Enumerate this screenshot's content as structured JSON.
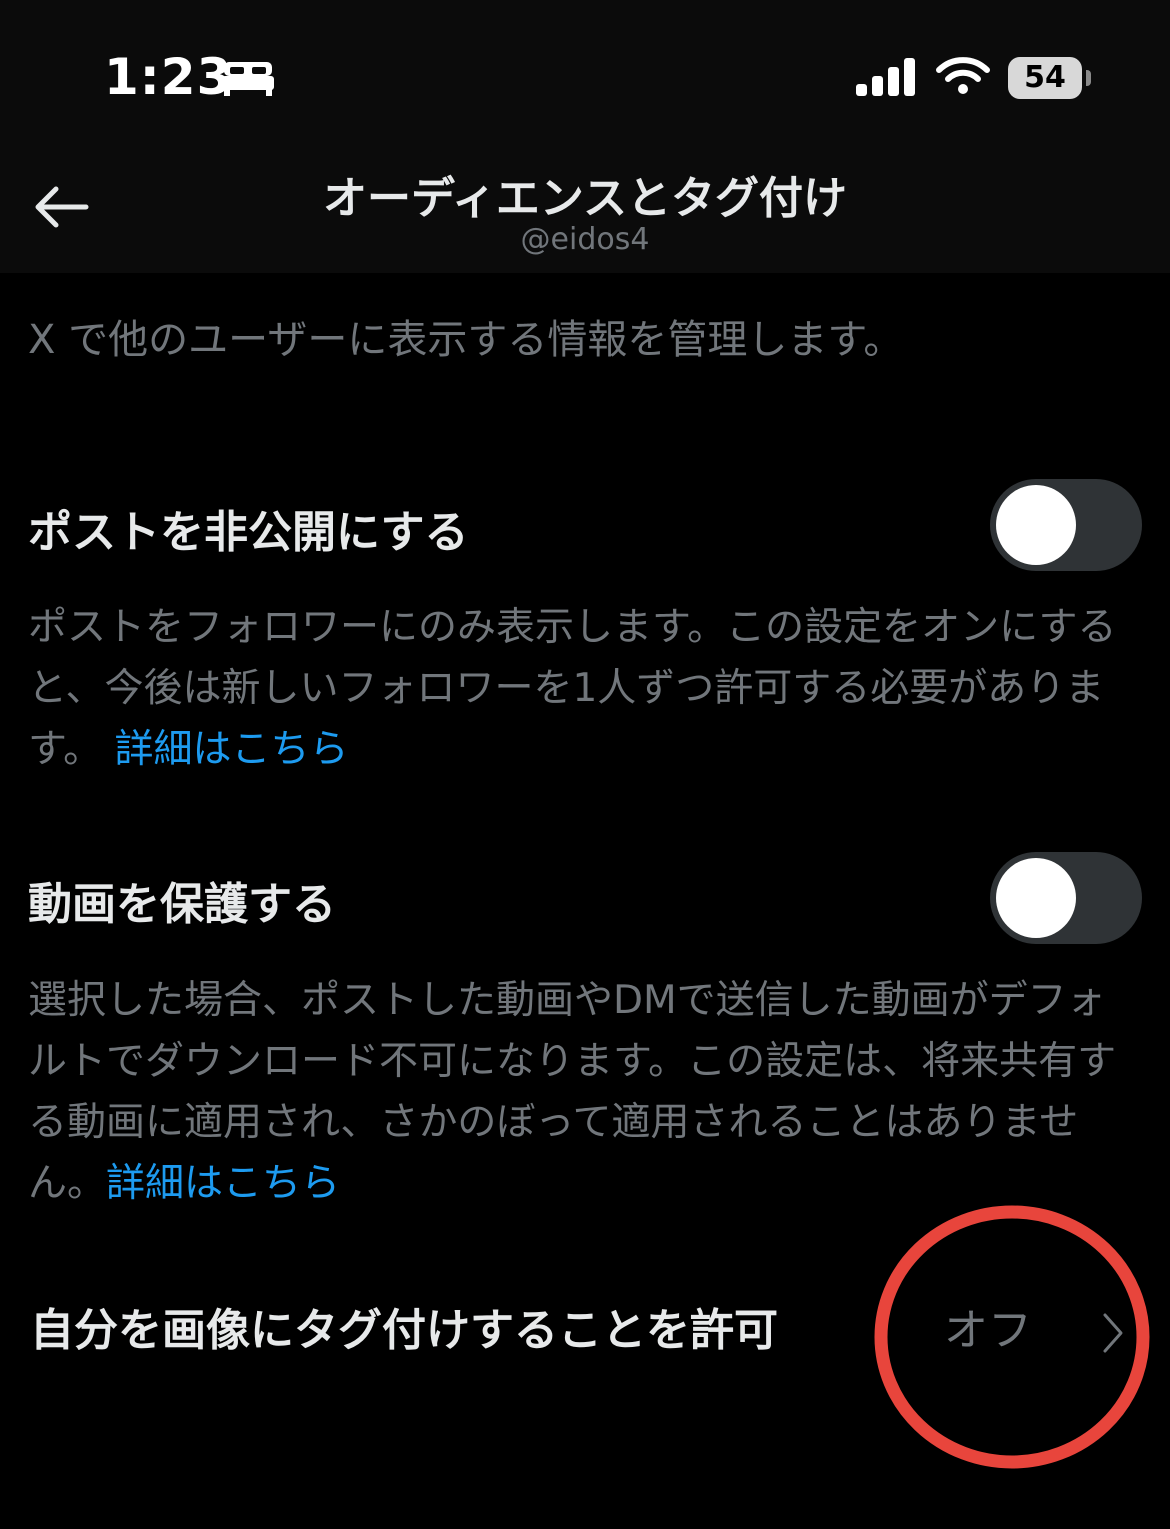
{
  "status_bar": {
    "time": "1:23",
    "battery": "54"
  },
  "header": {
    "title": "オーディエンスとタグ付け",
    "subtitle": "@eidos4"
  },
  "intro_text": "X で他のユーザーに表示する情報を管理します。",
  "settings": {
    "protect_posts": {
      "label": "ポストを非公開にする",
      "description": "ポストをフォロワーにのみ表示します。この設定をオンにすると、今後は新しいフォロワーを1人ずつ許可する必要があります。",
      "link": "詳細はこちら",
      "enabled": false
    },
    "protect_videos": {
      "label": "動画を保護する",
      "description": "選択した場合、ポストした動画やDMで送信した動画がデフォルトでダウンロード不可になります。この設定は、将来共有する動画に適用され、さかのぼって適用されることはありません。",
      "link": "詳細はこちら",
      "enabled": false
    },
    "photo_tagging": {
      "label": "自分を画像にタグ付けすることを許可",
      "value": "オフ"
    }
  },
  "colors": {
    "background": "#000000",
    "text_primary": "#e7e9ea",
    "text_secondary": "#71767b",
    "link": "#1d9bf0",
    "annotation": "#e8453c"
  }
}
